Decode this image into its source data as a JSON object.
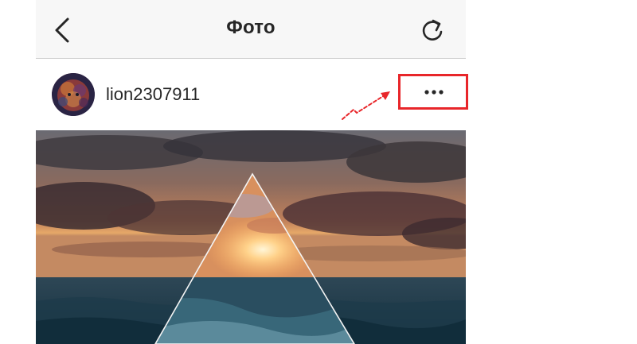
{
  "navbar": {
    "title": "Фото",
    "back_icon": "chevron-left-icon",
    "refresh_icon": "refresh-icon",
    "background": "#f7f7f7"
  },
  "post": {
    "username": "lion2307911",
    "avatar_icon": "lion-avatar",
    "more_icon": "more-dots-icon",
    "image_description_icon": "sunset-sea-triangle-photo"
  },
  "annotation": {
    "highlight_color": "#e8262a"
  }
}
